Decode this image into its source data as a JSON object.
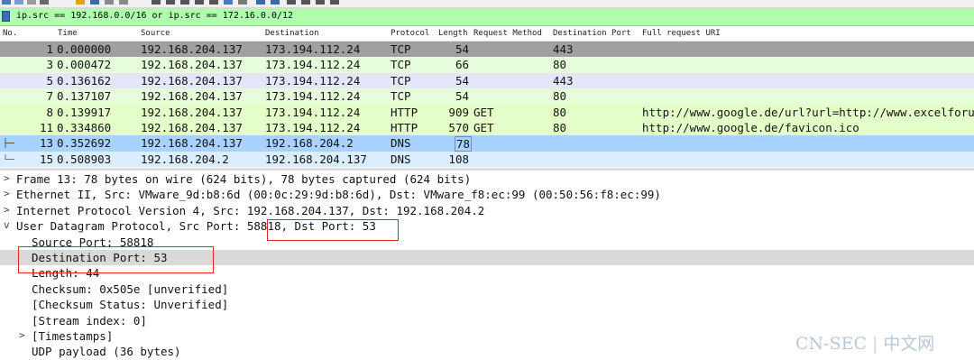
{
  "toolbar": {
    "icons": [
      "open-icon",
      "save-icon",
      "close-icon",
      "reload-icon",
      "search-icon",
      "back-icon",
      "forward-icon",
      "go-to-icon",
      "first-icon",
      "last-icon",
      "autoscroll-icon",
      "colorize-icon",
      "zoom-in-icon",
      "zoom-out-icon",
      "zoom-reset-icon"
    ]
  },
  "filter": {
    "value": "ip.src == 192.168.0.0/16 or ip.src == 172.16.0.0/12"
  },
  "columns": {
    "no": "No.",
    "time": "Time",
    "source": "Source",
    "destination": "Destination",
    "protocol": "Protocol",
    "length": "Length",
    "method": "Request Method",
    "dport": "Destination Port",
    "uri": "Full request URI"
  },
  "colors": {
    "tcp_gray": "#a0a0a0",
    "tcp_green": "#e7fcd8",
    "tcp_lavender": "#e6e6fa",
    "http_green": "#e4ffc7",
    "dns_selected": "#a8d2ff",
    "dns_blue": "#daeeff",
    "filter_bg": "#afffaf",
    "annotation": "#d82828"
  },
  "packets": [
    {
      "no": "1",
      "time": "0.000000",
      "src": "192.168.204.137",
      "dst": "173.194.112.24",
      "proto": "TCP",
      "len": "54",
      "method": "",
      "dport": "443",
      "uri": "",
      "color": "tcp_gray"
    },
    {
      "no": "3",
      "time": "0.000472",
      "src": "192.168.204.137",
      "dst": "173.194.112.24",
      "proto": "TCP",
      "len": "66",
      "method": "",
      "dport": "80",
      "uri": "",
      "color": "tcp_green"
    },
    {
      "no": "5",
      "time": "0.136162",
      "src": "192.168.204.137",
      "dst": "173.194.112.24",
      "proto": "TCP",
      "len": "54",
      "method": "",
      "dport": "443",
      "uri": "",
      "color": "tcp_lavender"
    },
    {
      "no": "7",
      "time": "0.137107",
      "src": "192.168.204.137",
      "dst": "173.194.112.24",
      "proto": "TCP",
      "len": "54",
      "method": "",
      "dport": "80",
      "uri": "",
      "color": "tcp_green"
    },
    {
      "no": "8",
      "time": "0.139917",
      "src": "192.168.204.137",
      "dst": "173.194.112.24",
      "proto": "HTTP",
      "len": "909",
      "method": "GET",
      "dport": "80",
      "uri": "http://www.google.de/url?url=http://www.excelforum",
      "color": "http_green"
    },
    {
      "no": "11",
      "time": "0.334860",
      "src": "192.168.204.137",
      "dst": "173.194.112.24",
      "proto": "HTTP",
      "len": "570",
      "method": "GET",
      "dport": "80",
      "uri": "http://www.google.de/favicon.ico",
      "color": "http_green"
    },
    {
      "no": "13",
      "time": "0.352692",
      "src": "192.168.204.137",
      "dst": "192.168.204.2",
      "proto": "DNS",
      "len": "78",
      "method": "",
      "dport": "",
      "uri": "",
      "color": "dns_selected"
    },
    {
      "no": "15",
      "time": "0.508903",
      "src": "192.168.204.2",
      "dst": "192.168.204.137",
      "proto": "DNS",
      "len": "108",
      "method": "",
      "dport": "",
      "uri": "",
      "color": "dns_blue"
    }
  ],
  "details": [
    {
      "text": "Frame 13: 78 bytes on wire (624 bits), 78 bytes captured (624 bits)",
      "level": 0,
      "expand": ">"
    },
    {
      "text": "Ethernet II, Src: VMware_9d:b8:6d (00:0c:29:9d:b8:6d), Dst: VMware_f8:ec:99 (00:50:56:f8:ec:99)",
      "level": 0,
      "expand": ">"
    },
    {
      "text": "Internet Protocol Version 4, Src: 192.168.204.137, Dst: 192.168.204.2",
      "level": 0,
      "expand": ">"
    },
    {
      "text": "User Datagram Protocol, Src Port: 58818, Dst Port: 53",
      "level": 0,
      "expand": "v"
    },
    {
      "text": "Source Port: 58818",
      "level": 1,
      "expand": ""
    },
    {
      "text": "Destination Port: 53",
      "level": 1,
      "expand": "",
      "selected": true
    },
    {
      "text": "Length: 44",
      "level": 1,
      "expand": ""
    },
    {
      "text": "Checksum: 0x505e [unverified]",
      "level": 1,
      "expand": ""
    },
    {
      "text": "[Checksum Status: Unverified]",
      "level": 1,
      "expand": ""
    },
    {
      "text": "[Stream index: 0]",
      "level": 1,
      "expand": ""
    },
    {
      "text": "[Timestamps]",
      "level": 1,
      "expand": ">"
    },
    {
      "text": "UDP payload (36 bytes)",
      "level": 1,
      "expand": ""
    }
  ],
  "watermark": {
    "left": "CN-SEC",
    "right": "中文网"
  }
}
